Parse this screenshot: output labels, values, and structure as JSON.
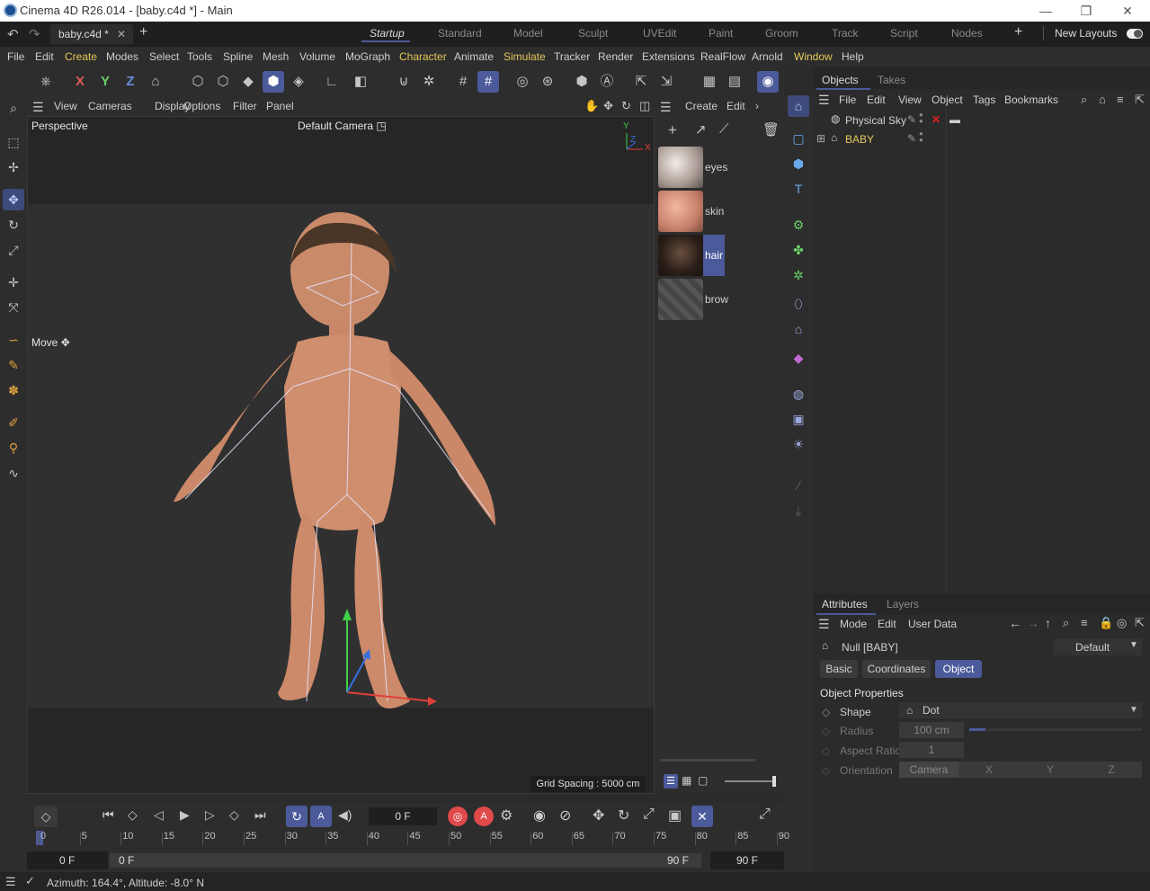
{
  "window": {
    "title": "Cinema 4D R26.014 - [baby.c4d *] - Main",
    "minimize": "—",
    "restore": "❐",
    "close": "✕"
  },
  "doc_tab": {
    "label": "baby.c4d *",
    "close": "✕",
    "add": "+"
  },
  "layouts": [
    "Startup",
    "Standard",
    "Model",
    "Sculpt",
    "UVEdit",
    "Paint",
    "Groom",
    "Track",
    "Script",
    "Nodes"
  ],
  "active_layout": "Startup",
  "new_layouts": "New Layouts",
  "menus": [
    "File",
    "Edit",
    "Create",
    "Modes",
    "Select",
    "Tools",
    "Spline",
    "Mesh",
    "Volume",
    "MoGraph",
    "Character",
    "Animate",
    "Simulate",
    "Tracker",
    "Render",
    "Extensions",
    "RealFlow",
    "Arnold",
    "Window",
    "Help"
  ],
  "toolbar_axes": [
    "X",
    "Y",
    "Z"
  ],
  "viewport": {
    "menus": [
      "View",
      "Cameras",
      "Display",
      "Options",
      "Filter",
      "Panel"
    ],
    "name": "Perspective",
    "camera": "Default Camera",
    "tool_hint": "Move",
    "grid_spacing": "Grid Spacing : 5000 cm",
    "axis_y": "Y",
    "axis_z": "Z",
    "axis_x": "X"
  },
  "materials": {
    "menus": [
      "Create",
      "Edit"
    ],
    "items": [
      {
        "name": "eyes"
      },
      {
        "name": "skin"
      },
      {
        "name": "hair"
      },
      {
        "name": "brow"
      }
    ],
    "selected": "hair"
  },
  "objects": {
    "tabs": [
      "Objects",
      "Takes"
    ],
    "menus": [
      "File",
      "Edit",
      "View",
      "Object",
      "Tags",
      "Bookmarks"
    ],
    "items": [
      {
        "name": "Physical Sky",
        "color": "#cfcfcf"
      },
      {
        "name": "BABY",
        "color": "#e6c75a"
      }
    ]
  },
  "attributes": {
    "tabs": [
      "Attributes",
      "Layers"
    ],
    "menus": [
      "Mode",
      "Edit",
      "User Data"
    ],
    "object_name": "Null [BABY]",
    "preset": "Default",
    "subtabs": [
      "Basic",
      "Coordinates",
      "Object"
    ],
    "active_subtab": "Object",
    "section": "Object Properties",
    "props": [
      {
        "label": "Shape",
        "value": "Dot"
      },
      {
        "label": "Radius",
        "value": "100 cm"
      },
      {
        "label": "Aspect Ratio",
        "value": "1"
      },
      {
        "label": "Orientation",
        "value": "Camera"
      }
    ],
    "orient_axes": [
      "X",
      "Y",
      "Z"
    ]
  },
  "timeline": {
    "current_frame": "0 F",
    "ticks": [
      "0",
      "5",
      "10",
      "15",
      "20",
      "25",
      "30",
      "35",
      "40",
      "45",
      "50",
      "55",
      "60",
      "65",
      "70",
      "75",
      "80",
      "85",
      "90"
    ],
    "start": "0 F",
    "range_start": "0 F",
    "range_end": "90 F",
    "end": "90 F"
  },
  "status": {
    "text": "Azimuth: 164.4°, Altitude: -8.0°  N"
  },
  "colors": {
    "accent": "#4b5a9a",
    "highlight": "#e6c75a",
    "x_axis": "#e0403a",
    "y_axis": "#3fd04a",
    "z_axis": "#3a6fe0"
  }
}
